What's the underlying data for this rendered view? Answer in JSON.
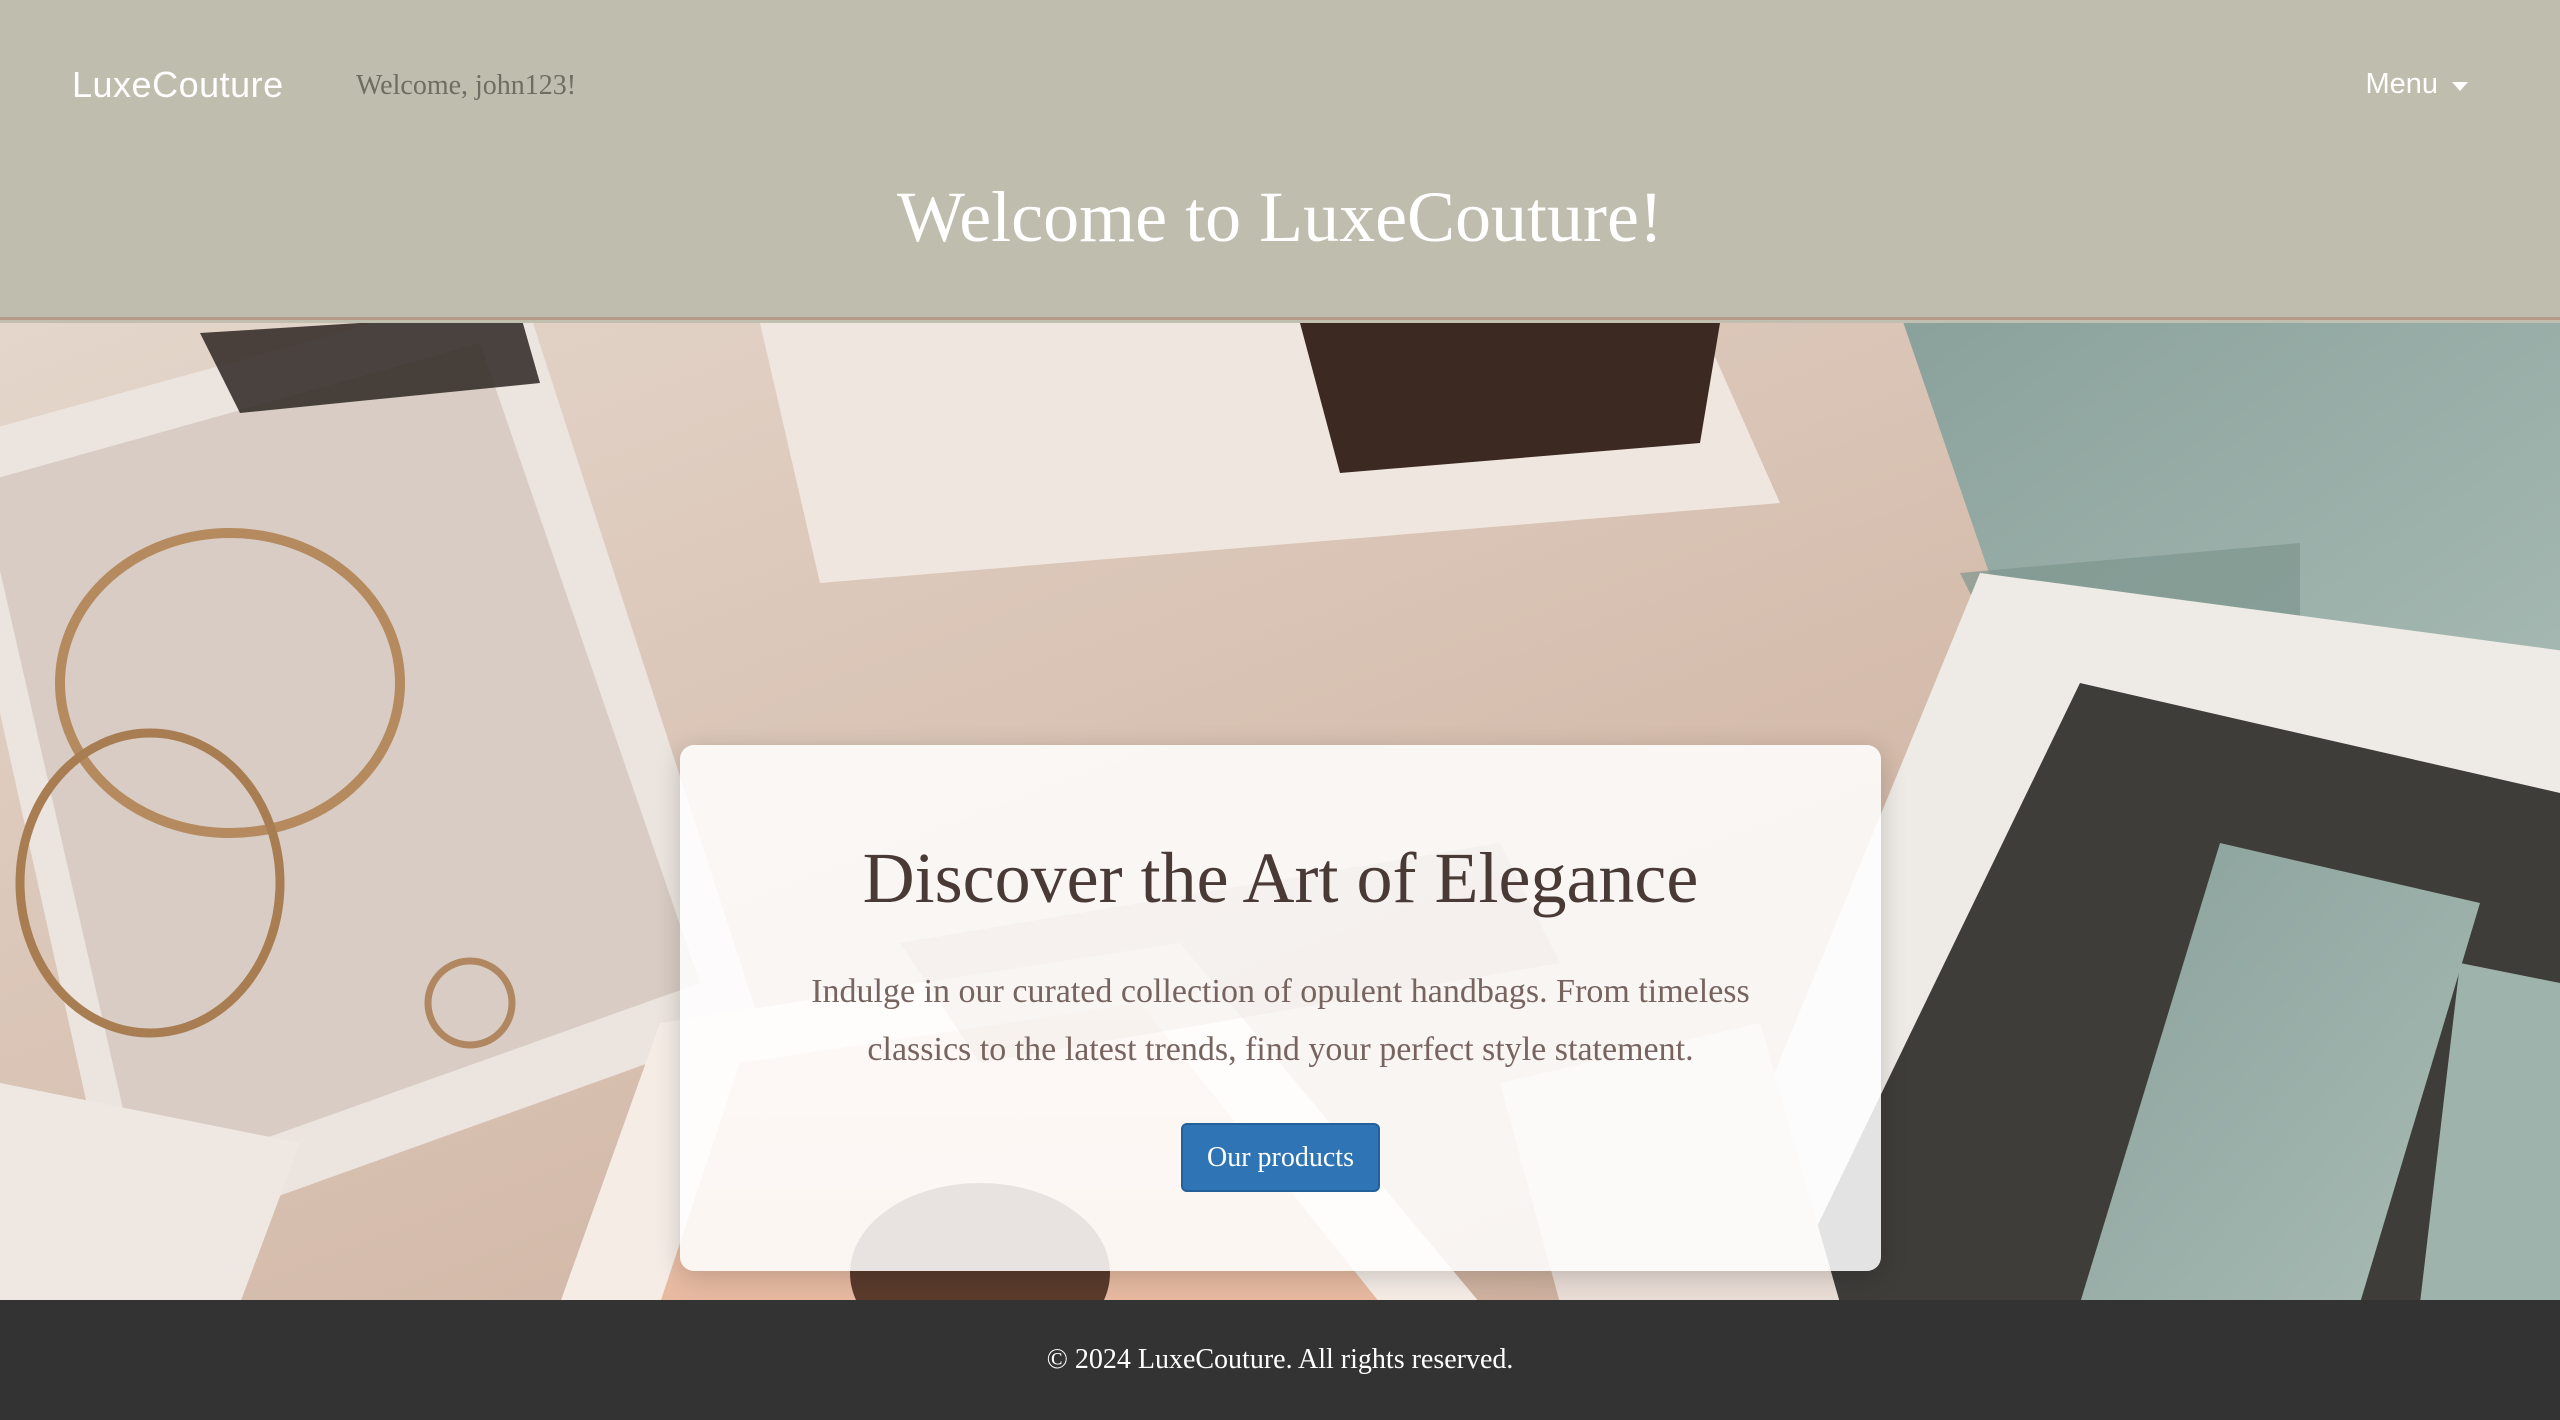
{
  "header": {
    "brand": "LuxeCouture",
    "welcome_user": "Welcome, john123!",
    "menu_label": "Menu",
    "hero_title": "Welcome to LuxeCouture!"
  },
  "card": {
    "title": "Discover the Art of Elegance",
    "description": "Indulge in our curated collection of opulent handbags. From timeless classics to the latest trends, find your perfect style statement.",
    "button_label": "Our products"
  },
  "footer": {
    "copyright": "© 2024 LuxeCouture. All rights reserved."
  },
  "icons": {
    "menu_caret": "caret-down-icon"
  },
  "colors": {
    "header_bg": "#bebdae",
    "accent_button": "#2f74b5",
    "footer_bg": "#333333",
    "card_title": "#4a3a35",
    "card_text": "#77645e"
  }
}
